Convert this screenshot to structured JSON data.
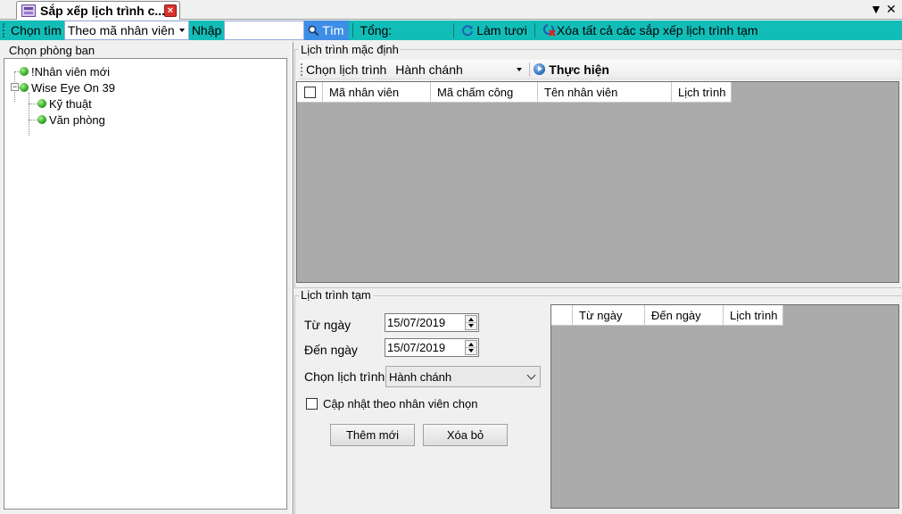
{
  "tab": {
    "title": "Sắp xếp lịch trình c...",
    "close_glyph": "×",
    "menu_glyph": "▼",
    "window_close_glyph": "✕"
  },
  "toolbar": {
    "search_by_label": "Chọn tìm",
    "search_by_value": "Theo mã nhân viên",
    "input_label": "Nhập",
    "input_value": "",
    "search_button": "Tìm",
    "total_label": "Tổng:",
    "total_value": "",
    "refresh_button": "Làm tươi",
    "clear_all_button": "Xóa tất cả các sắp xếp lịch trình tạm",
    "colors": {
      "bar": "#12bdb8",
      "search_button": "#3d8ee6"
    },
    "icons": [
      "search-icon",
      "refresh-icon",
      "delete-icon"
    ]
  },
  "departments": {
    "title": "Chọn phòng ban",
    "tree": [
      {
        "label": "!Nhân viên mới",
        "level": 0,
        "icon": "green-dot-icon"
      },
      {
        "label": "Wise Eye On 39",
        "level": 0,
        "icon": "green-dot-icon",
        "expanded": true,
        "expander": "−"
      },
      {
        "label": "Kỹ thuật",
        "level": 1,
        "icon": "green-dot-icon"
      },
      {
        "label": "Văn phòng",
        "level": 1,
        "icon": "green-dot-icon"
      }
    ]
  },
  "default_schedule": {
    "title": "Lịch trình mặc định",
    "choose_label": "Chọn lịch trình",
    "choose_value": "Hành chánh",
    "execute_button": "Thực hiện",
    "columns": [
      "Mã nhân viên",
      "Mã chấm công",
      "Tên nhân viên",
      "Lịch trình"
    ],
    "rows": []
  },
  "temp_schedule": {
    "title": "Lịch trình tạm",
    "from_label": "Từ ngày",
    "from_value": "15/07/2019",
    "to_label": "Đến ngày",
    "to_value": "15/07/2019",
    "choose_label": "Chọn lịch trình",
    "choose_value": "Hành chánh",
    "update_checkbox_label": "Cập nhật theo nhân viên chọn",
    "update_checked": false,
    "add_button": "Thêm mới",
    "delete_button": "Xóa bỏ",
    "columns": [
      "Từ ngày",
      "Đến ngày",
      "Lịch trình"
    ],
    "rows": []
  }
}
